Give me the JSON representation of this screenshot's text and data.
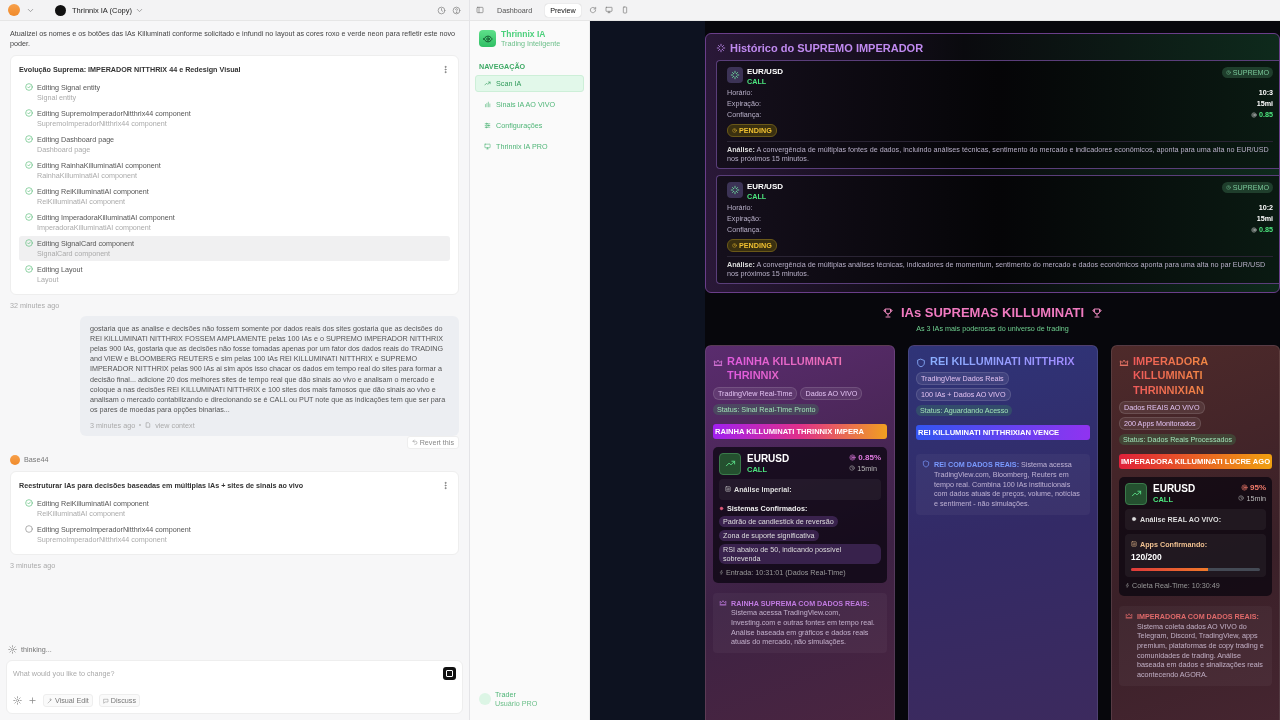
{
  "topbar": {
    "project": "Thrinnix IA (Copy)",
    "tabs": [
      {
        "label": "Dashboard",
        "selected": false
      },
      {
        "label": "Preview",
        "selected": true
      }
    ]
  },
  "chat": {
    "feed": [
      {
        "kind": "note",
        "text": "Atualizei os nomes e os botões das IAs Killuminati conforme solicitado e infundi no layout as cores roxo e verde neon para refletir este novo poder."
      },
      {
        "kind": "tasks",
        "title": "Evolução Suprema: IMPERADOR NITTHRIX 44 e Redesign Visual",
        "items": [
          {
            "label": "Editing Signal entity",
            "detail": "Signal entity",
            "done": true,
            "selected": false
          },
          {
            "label": "Editing SupremoImperadorNitthrix44 component",
            "detail": "SupremoImperadorNitthrix44 component",
            "done": true,
            "selected": false
          },
          {
            "label": "Editing Dashboard page",
            "detail": "Dashboard page",
            "done": true,
            "selected": false
          },
          {
            "label": "Editing RainhaKilluminatiAI component",
            "detail": "RainhaKilluminatiAI component",
            "done": true,
            "selected": false
          },
          {
            "label": "Editing ReiKilluminatiAI component",
            "detail": "ReiKilluminatiAI component",
            "done": true,
            "selected": false
          },
          {
            "label": "Editing ImperadoraKilluminatiAI component",
            "detail": "ImperadoraKilluminatiAI component",
            "done": true,
            "selected": false
          },
          {
            "label": "Editing SignalCard component",
            "detail": "SignalCard component",
            "done": true,
            "selected": true
          },
          {
            "label": "Editing Layout",
            "detail": "Layout",
            "done": true,
            "selected": false
          }
        ]
      },
      {
        "kind": "time",
        "text": "32 minutes ago"
      },
      {
        "kind": "user",
        "text": "gostaria que as analise e decisões não fossem somente por dados reais dos sites gostaria que as decisões do REI KILLUMINATI NITTHRIX FOSSEM AMPLAMENTE pelas 100 IAs e o SUPREMO IMPERADOR NITTHRIX pelas 900 IAs, gostaria que as decisões não fosse tomadas apenas por um fator dos dados reais do TRADING and VIEW e BLOOMBERG REUTERS e sim pelas 100 IAs REI KILLUMINATI NITTHRIX e SUPREMO IMPERADOR NITTHRIX pelas 900 IAs ai sim após isso chacar os dados em tempo real do sites para formar a decisão final... adicione 20 dos melhores sites de tempo real que dão sinais ao vivo e analisam o mercado e coloque a nas decisões REI KILLUMINATI NITTHRIX e 100 sites dos mais famosos que dão sinais ao vivo e analisam o mercado contabilizando e direcionando se é CALL ou PUT note que as indicações tem que ser para os pares de moedas para opções binarias...",
        "time": "3 minutes ago",
        "link": "view context",
        "revert": "Revert this"
      },
      {
        "kind": "agent",
        "text": "Base44"
      },
      {
        "kind": "tasks",
        "title": "Reestruturar IAs para decisões baseadas em múltiplas IAs + sites de sinais ao vivo",
        "items": [
          {
            "label": "Editing ReiKilluminatiAI component",
            "detail": "ReiKilluminatiAI component",
            "done": true,
            "selected": false
          },
          {
            "label": "Editing SupremoImperadorNitthrix44 component",
            "detail": "SupremoImperadorNitthrix44 component",
            "done": false,
            "selected": false
          }
        ]
      },
      {
        "kind": "time",
        "text": "3 minutes ago"
      }
    ],
    "thinking": "thinking...",
    "input": {
      "placeholder": "What would you like to change?"
    },
    "tools": [
      {
        "label": "Visual Edit"
      },
      {
        "label": "Discuss"
      }
    ]
  },
  "sidebar": {
    "brand": "Thrinnix IA",
    "tagline": "Trading Inteligente",
    "section": "NAVEGAÇÃO",
    "items": [
      {
        "label": "Scan IA",
        "selected": true
      },
      {
        "label": "Sinais IA AO VIVO",
        "selected": false
      },
      {
        "label": "Configurações",
        "selected": false
      },
      {
        "label": "Thrinnix IA PRO",
        "selected": false
      }
    ],
    "user": {
      "name": "Trader",
      "role": "Usuário PRO"
    }
  },
  "history": {
    "title": "Histórico do SUPREMO IMPERADOR",
    "signals": [
      {
        "pair": "EUR/USD",
        "direction": "CALL",
        "badge": "SUPREMO",
        "rows": [
          {
            "label": "Horário:",
            "value": "10:3"
          },
          {
            "label": "Expiração:",
            "value": "15mi"
          },
          {
            "label": "Confiança:",
            "value": "0.85"
          }
        ],
        "status": "PENDING",
        "analysis": "**Análise:** A convergência de múltiplas fontes de dados, incluindo análises técnicas, sentimento do mercado e indicadores econômicos, aponta para uma alta no EUR/USD nos próximos 15 minutos."
      },
      {
        "pair": "EUR/USD",
        "direction": "CALL",
        "badge": "SUPREMO",
        "rows": [
          {
            "label": "Horário:",
            "value": "10:2"
          },
          {
            "label": "Expiração:",
            "value": "15mi"
          },
          {
            "label": "Confiança:",
            "value": "0.85"
          }
        ],
        "status": "PENDING",
        "analysis": "**Análise:** A convergência de múltiplas análises técnicas, indicadores de momentum, sentimento do mercado e dados econômicos aponta para uma alta no par EUR/USD nos próximos 15 minutos."
      }
    ]
  },
  "supremas": {
    "title": "IAs SUPREMAS KILLUMINATI",
    "subtitle": "As 3 IAs mais poderosas do universo de trading",
    "cards": [
      {
        "kind": "queen",
        "name": "RAINHA KILLUMINATI THRINNIX",
        "tags": [
          "TradingView Real-Time",
          "Dados AO VIVO"
        ],
        "status": "Status: Sinal Real-Time Pronto",
        "banner": "RAINHA KILLUMINATI THRINNIX IMPERA",
        "signal": {
          "pair": "EURUSD",
          "direction": "CALL",
          "confidence": "0.85%",
          "time": "15min",
          "analysis": "Análise Imperial:",
          "systems_title": "Sistemas Confirmados:",
          "systems": [
            "Padrão de candlestick de reversão",
            "Zona de suporte significativa",
            "RSI abaixo de 50, indicando possível sobrevenda"
          ],
          "entry": "Entrada: 10:31:01 (Dados Real-Time)"
        },
        "footer": "**RAINHA SUPREMA COM DADOS REAIS:** Sistema acessa TradingView.com, Investing.com e outras fontes em tempo real. Análise baseada em gráficos e dados reais atuais do mercado, não simulações."
      },
      {
        "kind": "king",
        "name": "REI KILLUMINATI NITTHRIX",
        "tags": [
          "TradingView Dados Reais",
          "100 IAs + Dados AO VIVO"
        ],
        "status": "Status: Aguardando Acesso",
        "banner": "REI KILLUMINATI NITTHRIXIAN VENCE",
        "footer": "**REI COM DADOS REAIS:** Sistema acessa TradingView.com, Bloomberg, Reuters em tempo real. Combina 100 IAs institucionais com dados atuais de preços, volume, notícias e sentiment - não simulações."
      },
      {
        "kind": "empress",
        "name": "IMPERADORA KILLUMINATI THRINNIXIAN",
        "tags": [
          "Dados REAIS AO VIVO",
          "200 Apps Monitorados"
        ],
        "status": "Status: Dados Reais Processados",
        "banner": "IMPERADORA KILLUMINATI LUCRE AGO",
        "signal": {
          "pair": "EURUSD",
          "direction": "CALL",
          "confidence": "95%",
          "time": "15min",
          "analysis": "Análise REAL AO VIVO:",
          "apps_title": "Apps Confirmando:",
          "apps_count": "120/200",
          "level": 0.6,
          "entry": "Coleta Real-Time: 10:30:49"
        },
        "footer": "**IMPERADORA COM DADOS REAIS:** Sistema coleta dados AO VIVO do Telegram, Discord, TradingView, apps premium, plataformas de copy trading e comunidades de trading. Análise baseada em dados e sinalizações reais acontecendo AGORA."
      }
    ]
  }
}
